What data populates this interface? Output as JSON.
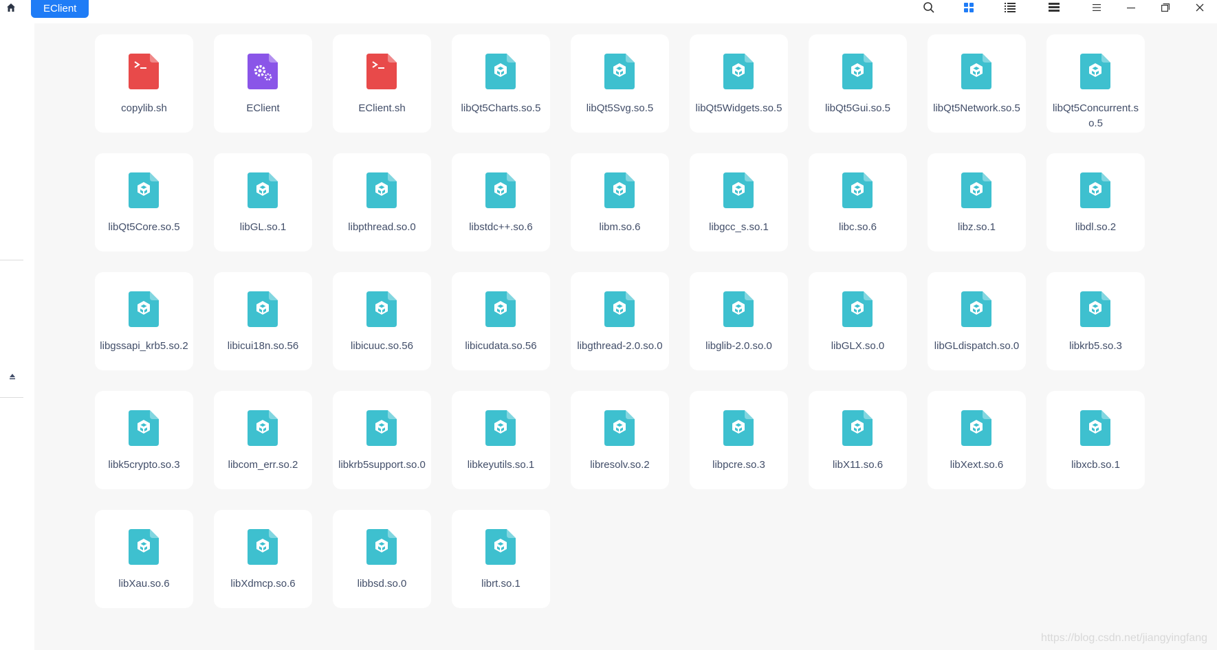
{
  "window": {
    "breadcrumb": "EClient",
    "toolbar": {
      "icons": [
        "search-icon",
        "icon-view-icon",
        "list-view-icon",
        "tree-view-icon",
        "menu-icon",
        "minimize-icon",
        "restore-icon",
        "close-icon"
      ]
    }
  },
  "colors": {
    "accent": "#1f7cf6",
    "lib": "#3ec0cf",
    "script": "#e84a4a",
    "exec": "#8a55e8"
  },
  "files": [
    {
      "name": "copylib.sh",
      "type": "script"
    },
    {
      "name": "EClient",
      "type": "exec"
    },
    {
      "name": "EClient.sh",
      "type": "script"
    },
    {
      "name": "libQt5Charts.so.5",
      "type": "lib"
    },
    {
      "name": "libQt5Svg.so.5",
      "type": "lib"
    },
    {
      "name": "libQt5Widgets.so.5",
      "type": "lib"
    },
    {
      "name": "libQt5Gui.so.5",
      "type": "lib"
    },
    {
      "name": "libQt5Network.so.5",
      "type": "lib"
    },
    {
      "name": "libQt5Concurrent.so.5",
      "type": "lib"
    },
    {
      "name": "libQt5Core.so.5",
      "type": "lib"
    },
    {
      "name": "libGL.so.1",
      "type": "lib"
    },
    {
      "name": "libpthread.so.0",
      "type": "lib"
    },
    {
      "name": "libstdc++.so.6",
      "type": "lib"
    },
    {
      "name": "libm.so.6",
      "type": "lib"
    },
    {
      "name": "libgcc_s.so.1",
      "type": "lib"
    },
    {
      "name": "libc.so.6",
      "type": "lib"
    },
    {
      "name": "libz.so.1",
      "type": "lib"
    },
    {
      "name": "libdl.so.2",
      "type": "lib"
    },
    {
      "name": "libgssapi_krb5.so.2",
      "type": "lib"
    },
    {
      "name": "libicui18n.so.56",
      "type": "lib"
    },
    {
      "name": "libicuuc.so.56",
      "type": "lib"
    },
    {
      "name": "libicudata.so.56",
      "type": "lib"
    },
    {
      "name": "libgthread-2.0.so.0",
      "type": "lib"
    },
    {
      "name": "libglib-2.0.so.0",
      "type": "lib"
    },
    {
      "name": "libGLX.so.0",
      "type": "lib"
    },
    {
      "name": "libGLdispatch.so.0",
      "type": "lib"
    },
    {
      "name": "libkrb5.so.3",
      "type": "lib"
    },
    {
      "name": "libk5crypto.so.3",
      "type": "lib"
    },
    {
      "name": "libcom_err.so.2",
      "type": "lib"
    },
    {
      "name": "libkrb5support.so.0",
      "type": "lib"
    },
    {
      "name": "libkeyutils.so.1",
      "type": "lib"
    },
    {
      "name": "libresolv.so.2",
      "type": "lib"
    },
    {
      "name": "libpcre.so.3",
      "type": "lib"
    },
    {
      "name": "libX11.so.6",
      "type": "lib"
    },
    {
      "name": "libXext.so.6",
      "type": "lib"
    },
    {
      "name": "libxcb.so.1",
      "type": "lib"
    },
    {
      "name": "libXau.so.6",
      "type": "lib"
    },
    {
      "name": "libXdmcp.so.6",
      "type": "lib"
    },
    {
      "name": "libbsd.so.0",
      "type": "lib"
    },
    {
      "name": "librt.so.1",
      "type": "lib"
    }
  ],
  "watermark": "https://blog.csdn.net/jiangyingfang"
}
